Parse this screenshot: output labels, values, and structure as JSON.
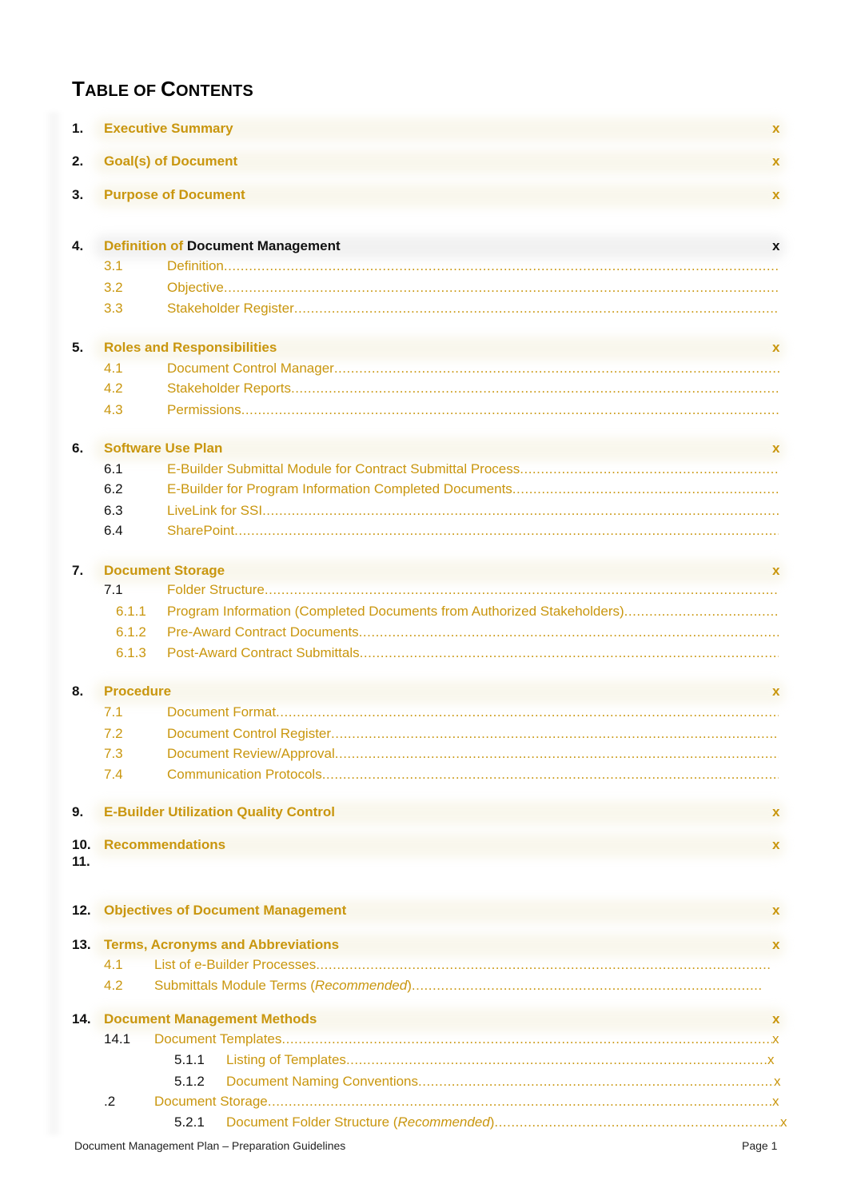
{
  "document": {
    "title_cap1": "T",
    "title_rest1": "ABLE OF ",
    "title_cap2": "C",
    "title_rest2": "ONTENTS",
    "accent_color": "#C9960E",
    "page_marker": "x"
  },
  "toc": {
    "sections": [
      {
        "num": "1.",
        "title": "Executive Summary",
        "page": "x"
      },
      {
        "num": "2.",
        "title": "Goal(s) of Document",
        "page": "x"
      },
      {
        "num": "3.",
        "title": "Purpose of Document",
        "page": "x"
      },
      {
        "num": "4.",
        "title_gold": "Definition of ",
        "title_black": "Document Management",
        "page": "x",
        "subs": [
          {
            "num": "3.1",
            "title": "Definition"
          },
          {
            "num": "3.2",
            "title": "Objective"
          },
          {
            "num": "3.3",
            "title": "Stakeholder Register"
          }
        ]
      },
      {
        "num": "5.",
        "title": "Roles and Responsibilities",
        "page": "x",
        "subs": [
          {
            "num": "4.1",
            "title": "Document Control Manager "
          },
          {
            "num": "4.2",
            "title": "Stakeholder Reports"
          },
          {
            "num": "4.3",
            "title": "Permissions"
          }
        ]
      },
      {
        "num": "6.",
        "title": "Software Use Plan",
        "page": "x",
        "subs": [
          {
            "num": "6.1",
            "title": "E-Builder Submittal Module for Contract Submittal Process "
          },
          {
            "num": "6.2",
            "title": "E-Builder for Program Information Completed Documents "
          },
          {
            "num": "6.3",
            "title": "LiveLink for SSI "
          },
          {
            "num": "6.4",
            "title": "SharePoint"
          }
        ]
      },
      {
        "num": "7.",
        "title": "Document Storage",
        "page": "x",
        "subs": [
          {
            "num": "7.1",
            "title": "Folder Structure"
          },
          {
            "num": "6.1.1",
            "title": "Program Information (Completed Documents from Authorized Stakeholders)"
          },
          {
            "num": "6.1.2",
            "title": "Pre-Award Contract Documents"
          },
          {
            "num": "6.1.3",
            "title": "Post-Award Contract Submittals"
          }
        ]
      },
      {
        "num": "8.",
        "title": "Procedure",
        "page": "x",
        "subs": [
          {
            "num": "7.1",
            "title": "Document Format"
          },
          {
            "num": "7.2",
            "title": "Document Control Register "
          },
          {
            "num": "7.3",
            "title": "Document Review/Approval"
          },
          {
            "num": "7.4",
            "title": "Communication Protocols"
          }
        ]
      },
      {
        "num": "9.",
        "title": "E-Builder Utilization Quality Control",
        "page": "x"
      },
      {
        "num": "10.",
        "title": "Recommendations",
        "page": "x"
      },
      {
        "num": "11.",
        "title": ""
      },
      {
        "num": "12.",
        "title": "Objectives of Document Management",
        "page": "x"
      },
      {
        "num": "13.",
        "title": "Terms, Acronyms and Abbreviations",
        "page": "x",
        "subs": [
          {
            "num": "4.1",
            "title": "List of e-Builder Processes "
          },
          {
            "num": "4.2",
            "title_pre": "Submittals Module Terms (",
            "title_italic": "Recommended",
            "title_post": ") "
          }
        ]
      },
      {
        "num": "14.",
        "title": "Document Management Methods",
        "page": "x",
        "subs": [
          {
            "num": "14.1",
            "title": "Document Templates",
            "page": "x"
          },
          {
            "num": "5.1.1",
            "title": "Listing of Templates ",
            "page": "x"
          },
          {
            "num": "5.1.2",
            "title": "Document Naming Conventions ",
            "page": "x"
          },
          {
            "num": ".2",
            "title": "Document Storage",
            "page": "x"
          },
          {
            "num": "5.2.1",
            "title_pre": "Document Folder Structure (",
            "title_italic": "Recommended",
            "title_post": ")",
            "page": "x"
          }
        ]
      }
    ]
  },
  "footer": {
    "left": "Document Management Plan – Preparation Guidelines",
    "right": "Page 1"
  }
}
